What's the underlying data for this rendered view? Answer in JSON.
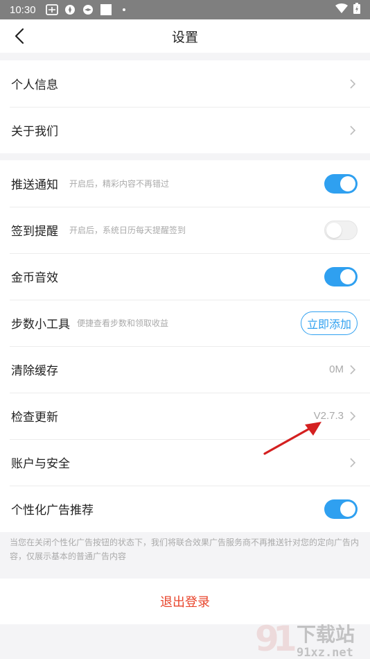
{
  "status_bar": {
    "time": "10:30"
  },
  "nav": {
    "title": "设置"
  },
  "group1": [
    {
      "label": "个人信息"
    },
    {
      "label": "关于我们"
    }
  ],
  "group2": {
    "push": {
      "label": "推送通知",
      "hint": "开启后，精彩内容不再错过",
      "enabled": true
    },
    "signin": {
      "label": "签到提醒",
      "hint": "开启后，系统日历每天提醒签到",
      "enabled": false
    },
    "coin": {
      "label": "金币音效",
      "enabled": true
    },
    "steps": {
      "label": "步数小工具",
      "hint": "便捷查看步数和领取收益",
      "button": "立即添加"
    },
    "cache": {
      "label": "清除缓存",
      "value": "0M"
    },
    "update": {
      "label": "检查更新",
      "value": "V2.7.3"
    },
    "account": {
      "label": "账户与安全"
    },
    "ads": {
      "label": "个性化广告推荐",
      "enabled": true
    }
  },
  "note": "当您在关闭个性化广告按钮的状态下，我们将联合效果广告服务商不再推送针对您的定向广告内容，仅展示基本的普通广告内容",
  "logout": "退出登录",
  "watermark": {
    "brand": "下载站",
    "url": "91xz.net"
  },
  "colors": {
    "accent": "#2fa0f0",
    "logout": "#e8452c",
    "annotation_arrow": "#d42020"
  }
}
